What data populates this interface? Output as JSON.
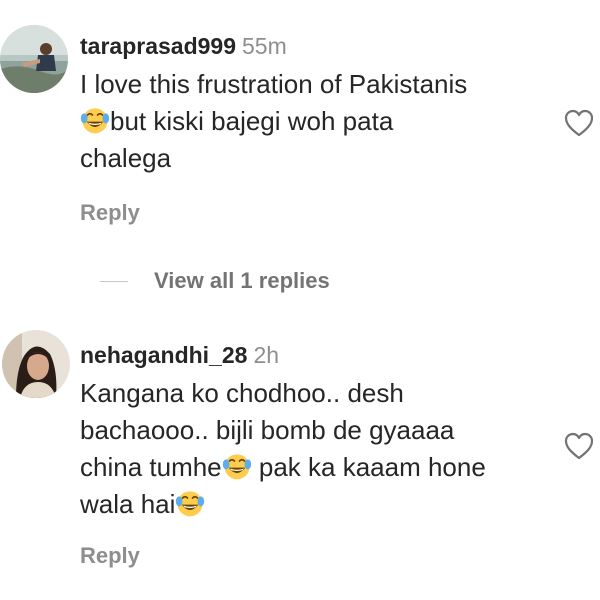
{
  "comments": [
    {
      "username": "taraprasad999",
      "timestamp": "55m",
      "lines": [
        "I love this frustration of Pakistanis",
        "but kiski bajegi woh pata",
        "chalega"
      ],
      "reply_label": "Reply",
      "emoji": "face-with-tears-of-joy"
    },
    {
      "username": "nehagandhi_28",
      "timestamp": "2h",
      "lines": [
        "Kangana ko chodhoo.. desh",
        "bachaooo.. bijli bomb de gyaaaa",
        "china tumhe",
        " pak ka kaaam hone",
        "wala hai"
      ],
      "reply_label": "Reply",
      "emoji": "face-with-tears-of-joy"
    }
  ],
  "view_replies_label": "View all 1 replies",
  "icons": {
    "like": "heart-icon",
    "emoji": "face-with-tears-of-joy-icon"
  },
  "colors": {
    "text": "#262626",
    "secondary": "#8e8e8e",
    "emoji_face": "#FFCC4D",
    "emoji_tear": "#5DADEC"
  }
}
